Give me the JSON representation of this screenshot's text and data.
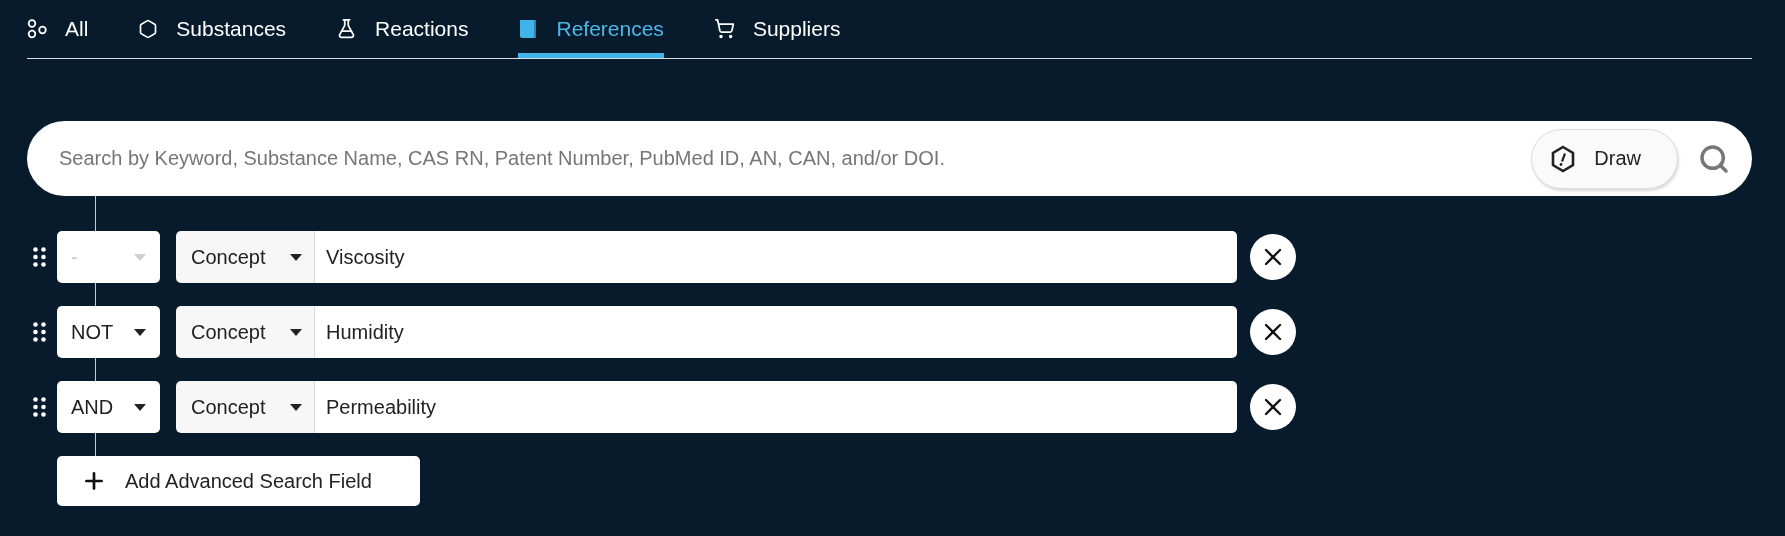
{
  "tabs": [
    {
      "label": "All",
      "kind": "all",
      "selected": false
    },
    {
      "label": "Substances",
      "kind": "substance",
      "selected": false
    },
    {
      "label": "Reactions",
      "kind": "flask",
      "selected": false
    },
    {
      "label": "References",
      "kind": "book",
      "selected": true
    },
    {
      "label": "Suppliers",
      "kind": "cart",
      "selected": false
    }
  ],
  "search": {
    "placeholder": "Search by Keyword, Substance Name, CAS RN, Patent Number, PubMed ID, AN, CAN, and/or DOI.",
    "draw_button": "Draw"
  },
  "rows": [
    {
      "operator": "-",
      "operator_disabled": true,
      "field": "Concept",
      "value": "Viscosity"
    },
    {
      "operator": "NOT",
      "operator_disabled": false,
      "field": "Concept",
      "value": "Humidity"
    },
    {
      "operator": "AND",
      "operator_disabled": false,
      "field": "Concept",
      "value": "Permeability"
    }
  ],
  "add_button": "Add Advanced Search Field"
}
